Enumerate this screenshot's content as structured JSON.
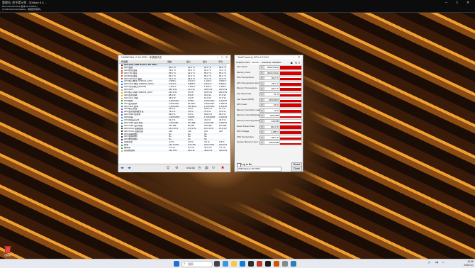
{
  "desktop": {
    "wallpaper": "abstract-golden-cubes-eye"
  },
  "cmd": {
    "title": "管理员: 命令提示符 - 3DMark 5.5 ...",
    "lines": [
      "Microsoft Windows [版本 10.0.22621]",
      "(c) Microsoft Corporation。保留所有权利。"
    ]
  },
  "hwinfo": {
    "title": "HWiNFO64 v7.16-4750 - 传感器状态",
    "columns": [
      "传感器",
      "当前",
      "最小",
      "最大",
      "平均"
    ],
    "rows": [
      {
        "name": "GPU [#0]: AMD Radeon RX 7900...",
        "cur": "",
        "min": "",
        "max": "",
        "avg": "",
        "icon": "chip",
        "head": true
      },
      {
        "name": "GPU温度",
        "cur": "60.0 °C",
        "min": "45.0 °C",
        "max": "62.0 °C",
        "avg": "58.5 °C",
        "icon": "temp"
      },
      {
        "name": "GPU热点温度",
        "cur": "78.0 °C",
        "min": "50.0 °C",
        "max": "81.0 °C",
        "avg": "76.0 °C",
        "icon": "temp"
      },
      {
        "name": "GPU VR 温度",
        "cur": "56.0 °C",
        "min": "42.0 °C",
        "max": "58.0 °C",
        "avg": "55.0 °C",
        "icon": "temp"
      },
      {
        "name": "GPU内存温度",
        "cur": "84.0 °C",
        "min": "60.0 °C",
        "max": "86.0 °C",
        "avg": "83.0 °C",
        "icon": "temp"
      },
      {
        "name": "GPU VR SoC 温度",
        "cur": "71.0 °C",
        "min": "48.0 °C",
        "max": "73.0 °C",
        "avg": "70.0 °C",
        "icon": "temp"
      },
      {
        "name": "GPU核心电压 (VDDCR_GFX)",
        "cur": "0.985 V",
        "min": "0.010 V",
        "max": "1.100 V",
        "avg": "0.950 V",
        "icon": "volt"
      },
      {
        "name": "GPU SoC 电压 (VDDCR_SOC)",
        "cur": "0.910 V",
        "min": "0.805 V",
        "max": "0.910 V",
        "avg": "0.900 V",
        "icon": "volt"
      },
      {
        "name": "GPU 内存电压 (MVDD)",
        "cur": "1.350 V",
        "min": "1.350 V",
        "max": "1.350 V",
        "avg": "1.350 V",
        "icon": "volt"
      },
      {
        "name": "GPU PPT",
        "cur": "262.0 W",
        "min": "12.0 W",
        "max": "265.0 W",
        "avg": "250.0 W",
        "icon": "power"
      },
      {
        "name": "GPU核心功耗 (VDDCR_GFX)",
        "cur": "210.0 W",
        "min": "5.0 W",
        "max": "215.0 W",
        "avg": "200.0 W",
        "icon": "power"
      },
      {
        "name": "GPU显存功耗",
        "cur": "28.0 W",
        "min": "8.0 W",
        "max": "30.0 W",
        "avg": "27.0 W",
        "icon": "power"
      },
      {
        "name": "GPU SoC 功耗",
        "cur": "18.0 W",
        "min": "4.0 W",
        "max": "19.0 W",
        "avg": "17.5 W",
        "icon": "power"
      },
      {
        "name": "GPU频率",
        "cur": "2,490 MHz",
        "min": "5 MHz",
        "max": "2,600 MHz",
        "avg": "2,410 MHz",
        "icon": "clock"
      },
      {
        "name": "GPU显存频率",
        "cur": "2,500 MHz",
        "min": "96 MHz",
        "max": "2,500 MHz",
        "avg": "2,480 MHz",
        "icon": "clock"
      },
      {
        "name": "GPU SoC 频率",
        "cur": "1,200 MHz",
        "min": "400 MHz",
        "max": "1,200 MHz",
        "avg": "1,190 MHz",
        "icon": "clock"
      },
      {
        "name": "GPU核心负载",
        "cur": "99.0 %",
        "min": "0.0 %",
        "max": "100.0 %",
        "avg": "97.0 %",
        "icon": "load"
      },
      {
        "name": "GPU显存控制器负载",
        "cur": "73.0 %",
        "min": "0.0 %",
        "max": "75.0 %",
        "avg": "70.0 %",
        "icon": "load"
      },
      {
        "name": "GPU D3D 使用率",
        "cur": "99.0 %",
        "min": "0.0 %",
        "max": "100.0 %",
        "avg": "96.0 %",
        "icon": "load"
      },
      {
        "name": "GPU风扇",
        "cur": "1,650 RPM",
        "min": "0 RPM",
        "max": "1,700 RPM",
        "avg": "1,600 RPM",
        "icon": "fan"
      },
      {
        "name": "GPU风扇占空比",
        "cur": "41.0 %",
        "min": "0.0 %",
        "max": "43.0 %",
        "avg": "40.0 %",
        "icon": "fan"
      },
      {
        "name": "GPU D3D 显存专用",
        "cur": "2,304 MB",
        "min": "512 MB",
        "max": "2,320 MB",
        "avg": "2,290 MB",
        "icon": "mem"
      },
      {
        "name": "GPU D3D 显存动态",
        "cur": "196 MB",
        "min": "80 MB",
        "max": "200 MB",
        "avg": "190 MB",
        "icon": "mem"
      },
      {
        "name": "GPU PCIe 链路速度",
        "cur": "16.0 GT/s",
        "min": "2.5 GT/s",
        "max": "16.0 GT/s",
        "avg": "15.8 GT/s",
        "icon": "chip"
      },
      {
        "name": "GPU PCIe 链路宽度",
        "cur": "x16",
        "min": "x16",
        "max": "x16",
        "avg": "x16",
        "icon": "chip"
      },
      {
        "name": "GPU功耗限制",
        "cur": "No",
        "min": "No",
        "max": "No",
        "avg": "",
        "icon": "chip"
      },
      {
        "name": "GPU温度限制",
        "cur": "No",
        "min": "No",
        "max": "No",
        "avg": "",
        "icon": "chip"
      },
      {
        "name": "GPU电流限制",
        "cur": "No",
        "min": "No",
        "max": "No",
        "avg": "",
        "icon": "chip"
      },
      {
        "name": "总线带宽",
        "cur": "2.0 %",
        "min": "0.0 %",
        "max": "3.0 %",
        "avg": "1.8 %",
        "icon": "load"
      },
      {
        "name": "帧率",
        "cur": "142.0 FPS",
        "min": "0.0 FPS",
        "max": "160.0 FPS",
        "avg": "138.0 FPS",
        "icon": "clock"
      },
      {
        "name": "帧时间",
        "cur": "7.0 ms",
        "min": "6.2 ms",
        "max": "30.0 ms",
        "avg": "7.2 ms",
        "icon": "clock"
      },
      {
        "name": "总系统功耗",
        "cur": "410.0 W",
        "min": "90.0 W",
        "max": "420.0 W",
        "avg": "400.0 W",
        "icon": "power"
      }
    ],
    "status_time": "0:02:34"
  },
  "gpuz": {
    "title": "TechPowerUp GPU-Z 2.53.0",
    "tabs": [
      "Graphics Card",
      "Sensors",
      "Advanced",
      "Validation"
    ],
    "sensors": [
      {
        "label": "GPU Clock",
        "value": "2490.0 MHz",
        "level": 0.95
      },
      {
        "label": "Memory Clock",
        "value": "2500.0 MHz",
        "level": 1.0
      },
      {
        "label": "GPU Temperature",
        "value": "60.0 °C",
        "level": 0.7
      },
      {
        "label": "GPU Temperature (Hot Spot)",
        "value": "78.0 °C",
        "level": 0.8
      },
      {
        "label": "Memory Temperature",
        "value": "84.0 °C",
        "level": 0.85
      },
      {
        "label": "Fan Speed (%)",
        "value": "41 %",
        "level": 0.6
      },
      {
        "label": "Fan Speed (RPM)",
        "value": "1650 RPM",
        "level": 0.6
      },
      {
        "label": "GPU Load",
        "value": "99 %",
        "level": 0.98
      },
      {
        "label": "Memory Controller Load",
        "value": "73 %",
        "level": 0.72
      },
      {
        "label": "Memory Used (Dedicated)",
        "value": "2304 MB",
        "level": 0.55
      },
      {
        "label": "Memory Used (Dynamic)",
        "value": "196 MB",
        "level": 0.4
      },
      {
        "label": "Board Power Draw",
        "value": "262.0 W",
        "level": 0.9
      },
      {
        "label": "GPU Voltage",
        "value": "0.985 V",
        "level": 0.75
      },
      {
        "label": "CPU Temperature",
        "value": "68.0 °C",
        "level": 0.65
      },
      {
        "label": "System Memory Used",
        "value": "10120 MB",
        "level": 0.5
      }
    ],
    "log_label": "Log to file",
    "reset_label": "Reset",
    "device": "AMD Radeon RX 7900 ...",
    "close_label": "Close"
  },
  "recycle_bin": {
    "label": "回收站"
  },
  "taskbar": {
    "search_placeholder": "搜索",
    "time": "15:58",
    "date": "2023/1/1",
    "lang": "中"
  }
}
